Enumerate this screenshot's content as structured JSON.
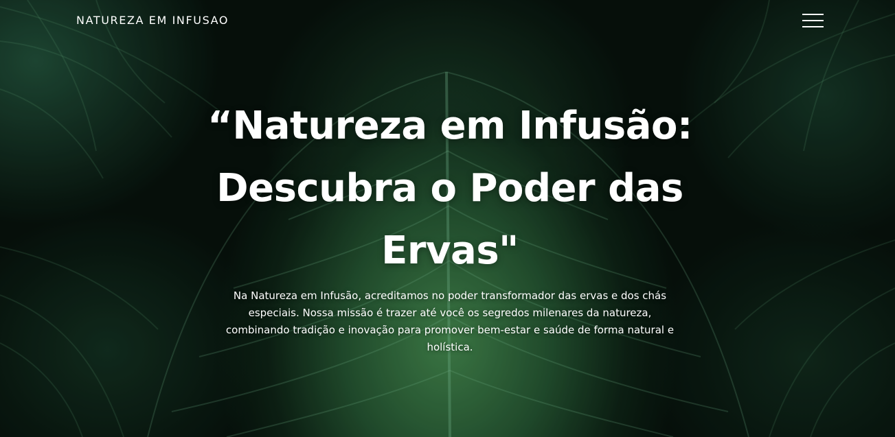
{
  "header": {
    "brand": "NATUREZA EM INFUSAO",
    "menu_icon": "hamburger-menu-icon"
  },
  "hero": {
    "headline": "“Natureza em Infusão: Descubra o Poder das Ervas\"",
    "intro": "Na Natureza em Infusão, acreditamos no poder transformador das ervas e dos chás especiais. Nossa missão é trazer até você os segredos milenares da natureza, combinando tradição e inovação para promover bem-estar e saúde de forma natural e holística.",
    "background_image": "dark-green-leaf-veins"
  },
  "colors": {
    "text": "#ffffff",
    "background_dark": "#07120c",
    "leaf_green": "#468c50"
  }
}
